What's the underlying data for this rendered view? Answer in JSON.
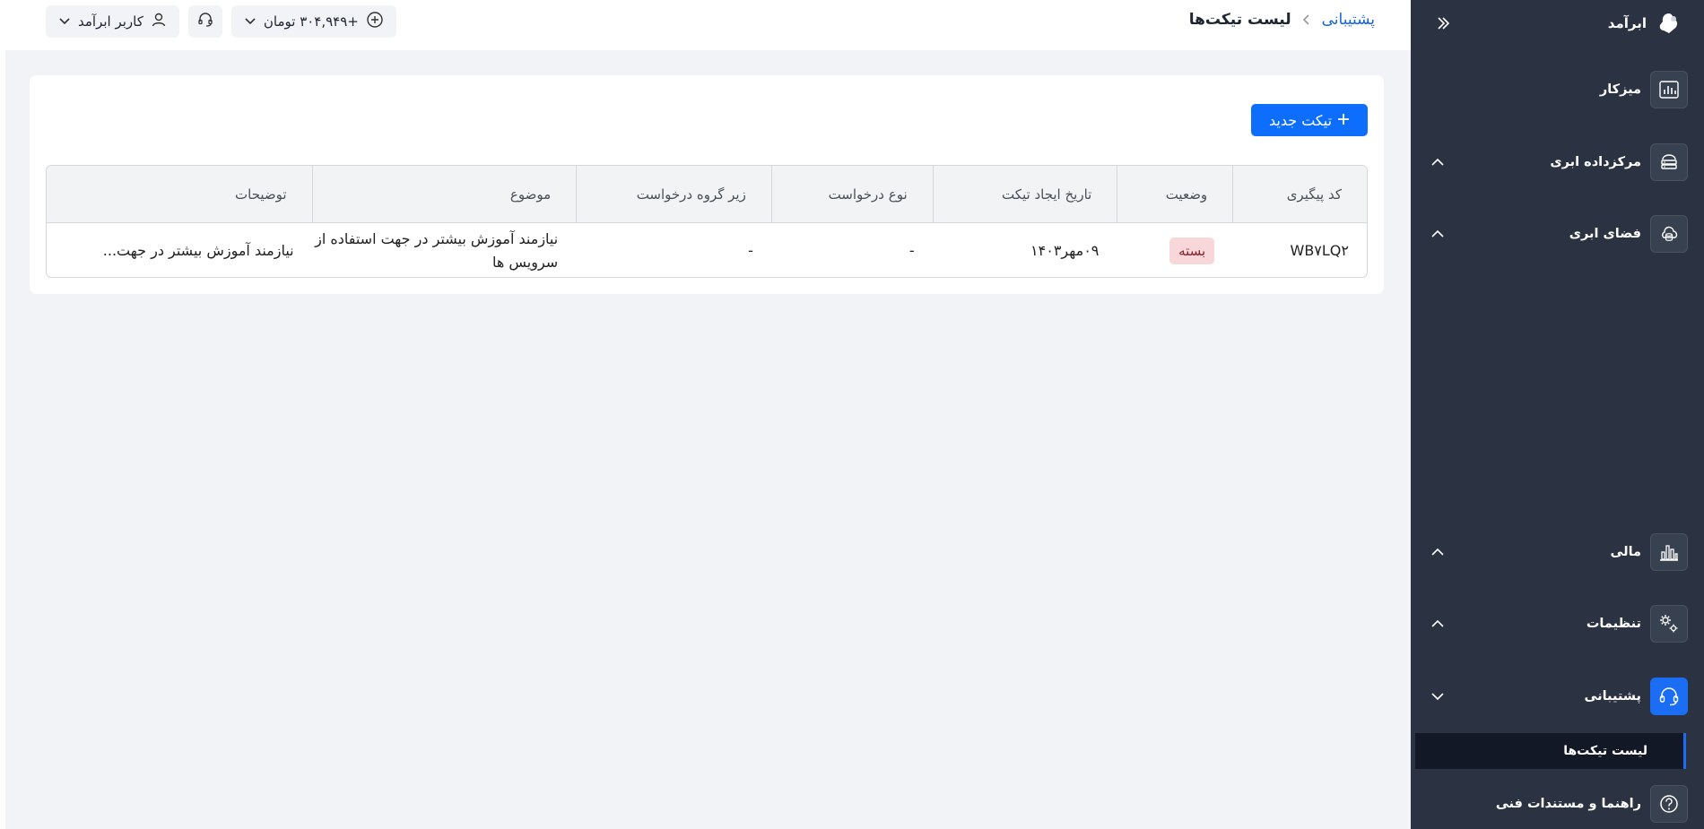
{
  "sidebar": {
    "brand": "ابرآمد",
    "items": [
      {
        "label": "میزکار",
        "icon": "dashboard-chart-icon"
      },
      {
        "label": "مرکزداده ابری",
        "icon": "datacenter-icon"
      },
      {
        "label": "فضای ابری",
        "icon": "cloud-storage-icon"
      },
      {
        "label": "مالی",
        "icon": "finance-chart-icon"
      },
      {
        "label": "تنظیمات",
        "icon": "gears-icon"
      },
      {
        "label": "پشتیبانی",
        "icon": "headset-icon"
      },
      {
        "label": "راهنما و مستندات فنی",
        "icon": "help-icon"
      }
    ],
    "active_sub_item": "لیست تیکت‌ها"
  },
  "header": {
    "breadcrumb_parent": "پشتیبانی",
    "breadcrumb_current": "لیست تیکت‌ها",
    "balance": "+۳۰۴,۹۴۹ تومان",
    "user": "کاربر ابرآمد"
  },
  "main": {
    "new_ticket_label": "تیکت جدید",
    "table": {
      "headers": [
        "کد پیگیری",
        "وضعیت",
        "تاریخ ایجاد تیکت",
        "نوع درخواست",
        "زیر گروه درخواست",
        "موضوع",
        "توضیحات"
      ],
      "rows": [
        {
          "code": "WB۷LQ۲",
          "status": "بسته",
          "date": "۰۹مهر۱۴۰۳",
          "type": "-",
          "subgroup": "-",
          "subject": "نیازمند آموزش بیشتر در جهت استفاده از سرویس ها",
          "description": "نیازمند آموزش بیشتر در جهت..."
        }
      ]
    }
  },
  "colors": {
    "sidebar_bg": "#2b3342",
    "accent": "#0d6efd",
    "status_closed_bg": "#f8d7da"
  }
}
